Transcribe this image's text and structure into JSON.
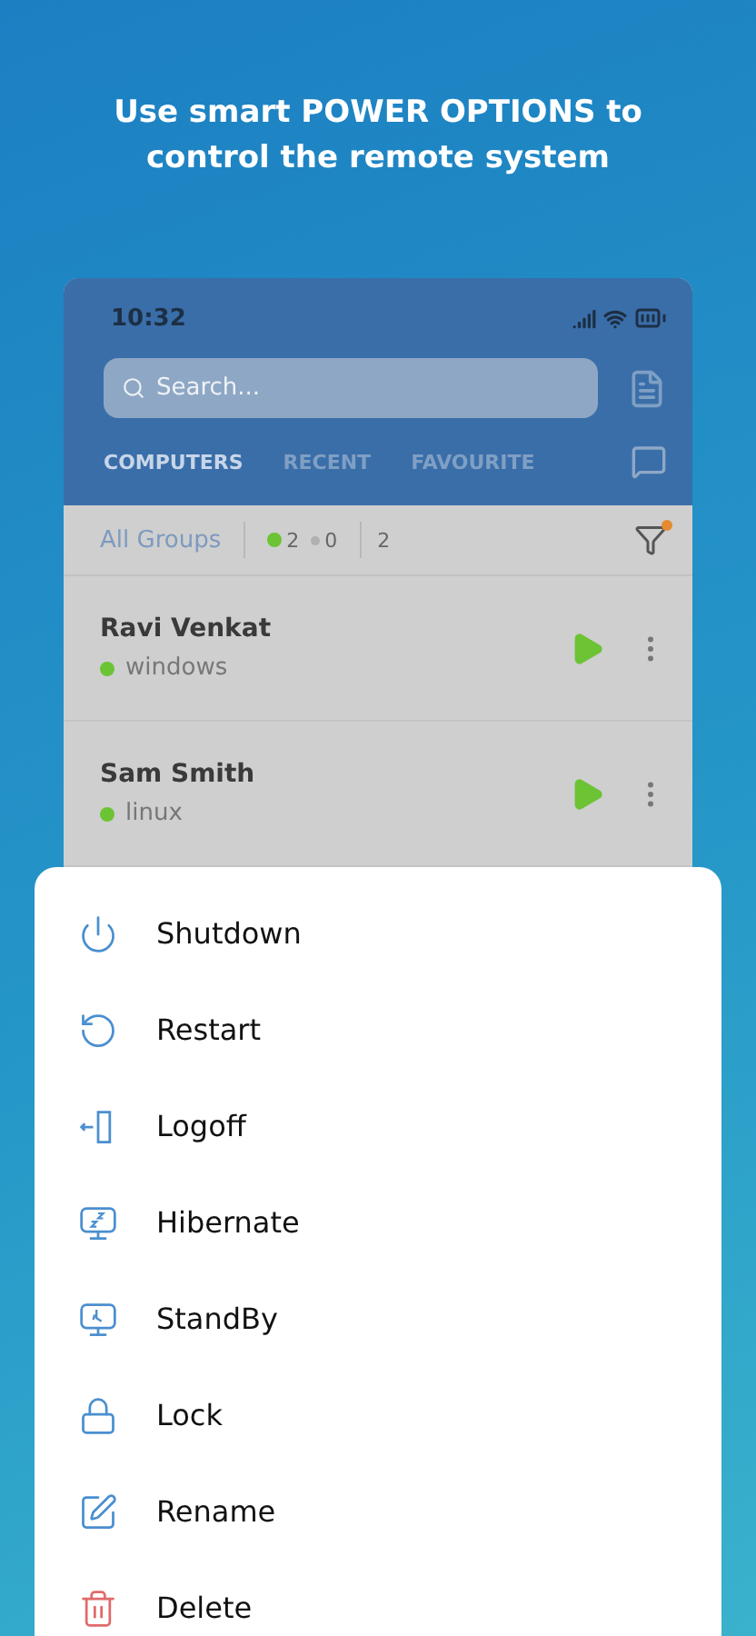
{
  "headline": "Use smart POWER OPTIONS to control the remote system",
  "phone": {
    "status_bar": {
      "time": "10:32"
    },
    "search": {
      "placeholder": "Search..."
    },
    "tabs": [
      {
        "label": "COMPUTERS",
        "selected": true
      },
      {
        "label": "RECENT",
        "selected": false
      },
      {
        "label": "FAVOURITE",
        "selected": false
      }
    ],
    "filter_bar": {
      "group": "All Groups",
      "online_count": "2",
      "offline_count": "0",
      "total_count": "2",
      "filter_active": true
    },
    "computers": [
      {
        "name": "Ravi Venkat",
        "os": "windows",
        "color": "#6cc334"
      },
      {
        "name": "Sam Smith",
        "os": "linux",
        "color": "#6cc334"
      }
    ]
  },
  "menu": [
    {
      "label": "Shutdown",
      "kind": "normal"
    },
    {
      "label": "Restart",
      "kind": "normal"
    },
    {
      "label": "Logoff",
      "kind": "normal"
    },
    {
      "label": "Hibernate",
      "kind": "normal"
    },
    {
      "label": "StandBy",
      "kind": "normal"
    },
    {
      "label": "Lock",
      "kind": "normal"
    },
    {
      "label": "Rename",
      "kind": "normal"
    },
    {
      "label": "Delete",
      "kind": "danger"
    }
  ]
}
